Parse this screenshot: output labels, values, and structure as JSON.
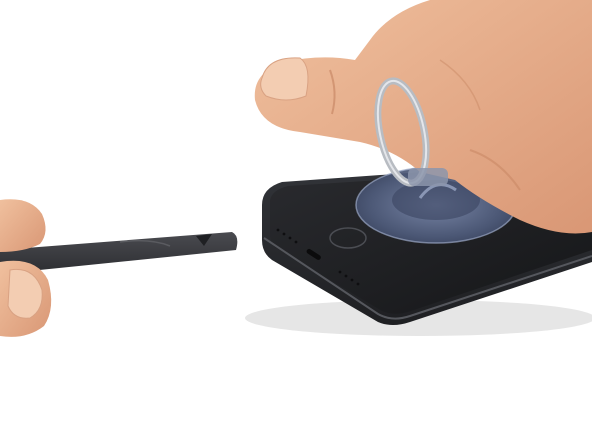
{
  "scene": {
    "kind": "photo",
    "subjects": [
      "phone",
      "suction-cup",
      "ring",
      "spudger",
      "hand-right",
      "hand-left"
    ],
    "colors": {
      "background": "#ffffff",
      "phone_body": "#2b2d31",
      "phone_glass": "#1c1d20",
      "suction_cup": "#5a6a8c",
      "spudger": "#3a3b3f",
      "skin": "#e7b08c",
      "skin_shadow": "#c98966",
      "ring_metal": "#b8bcc2"
    }
  }
}
